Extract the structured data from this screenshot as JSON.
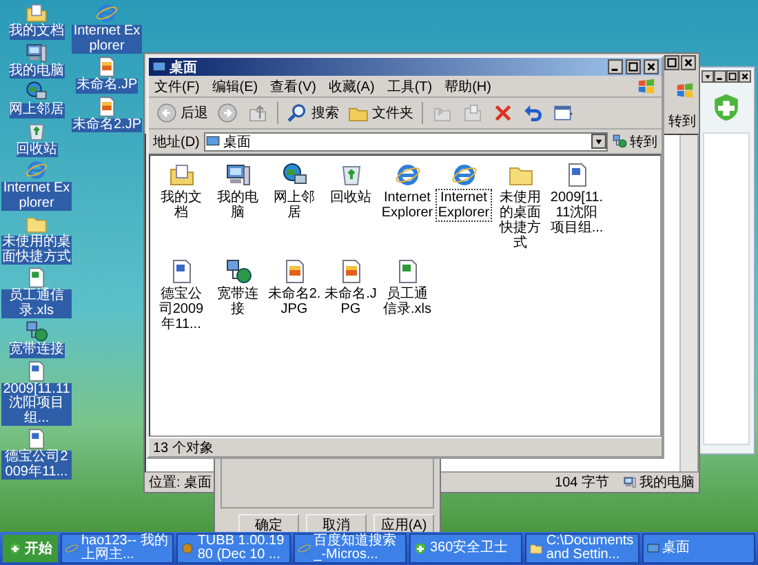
{
  "desktop": {
    "columns": [
      {
        "icons": [
          {
            "label": "我的文档",
            "kind": "documents"
          },
          {
            "label": "我的电脑",
            "kind": "computer"
          },
          {
            "label": "网上邻居",
            "kind": "network"
          },
          {
            "label": "回收站",
            "kind": "recycle"
          },
          {
            "label": "Internet Explorer",
            "kind": "browser"
          },
          {
            "label": "未使用的桌面快捷方式",
            "kind": "folder"
          },
          {
            "label": "员工通信录.xls",
            "kind": "spreadsheet"
          },
          {
            "label": "宽带连接",
            "kind": "connection"
          },
          {
            "label": "2009[11.11沈阳项目组...",
            "kind": "word"
          },
          {
            "label": "德宝公司2009年11...",
            "kind": "word"
          }
        ]
      },
      {
        "icons": [
          {
            "label": "Internet Explorer",
            "kind": "browser"
          },
          {
            "label": "未命名.JP",
            "kind": "image"
          },
          {
            "label": "未命名2.JP",
            "kind": "image"
          }
        ]
      }
    ]
  },
  "background_window": {
    "go_button": "转到",
    "status": [
      "位置: 桌面",
      "104 字节",
      "我的电脑"
    ]
  },
  "dialog": {
    "buttons": [
      "确定",
      "取消",
      "应用(A)"
    ]
  },
  "explorer": {
    "title": "桌面",
    "menu": [
      "文件(F)",
      "编辑(E)",
      "查看(V)",
      "收藏(A)",
      "工具(T)",
      "帮助(H)"
    ],
    "toolbar": [
      {
        "kind": "back",
        "label": "后退"
      },
      {
        "kind": "forward"
      },
      {
        "kind": "up"
      },
      {
        "kind": "search",
        "label": "搜索"
      },
      {
        "kind": "folders",
        "label": "文件夹"
      },
      {
        "kind": "move"
      },
      {
        "kind": "copy"
      },
      {
        "kind": "delete"
      },
      {
        "kind": "undo"
      },
      {
        "kind": "views"
      }
    ],
    "address": {
      "label": "地址(D)",
      "value": "桌面",
      "go_button": "转到"
    },
    "items": [
      {
        "label": "我的文档",
        "kind": "documents",
        "selected": false
      },
      {
        "label": "我的电脑",
        "kind": "computer",
        "selected": false
      },
      {
        "label": "网上邻居",
        "kind": "network",
        "selected": false
      },
      {
        "label": "回收站",
        "kind": "recycle",
        "selected": false
      },
      {
        "label": "Internet Explorer",
        "kind": "browser",
        "selected": false
      },
      {
        "label": "Internet Explorer",
        "kind": "browser",
        "selected": true
      },
      {
        "label": "未使用的桌面快捷方式",
        "kind": "folder",
        "selected": false
      },
      {
        "label": "2009[11.11沈阳项目组...",
        "kind": "word",
        "selected": false
      },
      {
        "label": "德宝公司2009年11...",
        "kind": "word",
        "selected": false
      },
      {
        "label": "宽带连接",
        "kind": "connection",
        "selected": false
      },
      {
        "label": "未命名2.JPG",
        "kind": "image",
        "selected": false
      },
      {
        "label": "未命名.JPG",
        "kind": "image",
        "selected": false
      },
      {
        "label": "员工通信录.xls",
        "kind": "spreadsheet",
        "selected": false
      }
    ],
    "status": "13 个对象"
  },
  "taskbar": {
    "start": "开始",
    "tasks": [
      {
        "label": "hao123-- 我的上网主...",
        "kind": "browser"
      },
      {
        "label": "TUBB 1.00.1980 (Dec 10 ...",
        "kind": "app"
      },
      {
        "label": "百度知道搜索_-Micros...",
        "kind": "browser"
      },
      {
        "label": "360安全卫士",
        "kind": "shield"
      },
      {
        "label": "C:\\Documents and Settin...",
        "kind": "folder"
      },
      {
        "label": "桌面",
        "kind": "desktop"
      }
    ]
  }
}
